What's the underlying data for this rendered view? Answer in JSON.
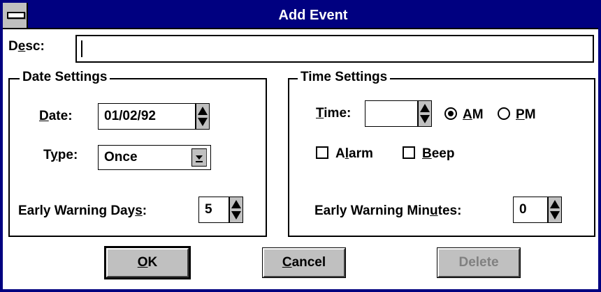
{
  "window": {
    "title": "Add Event"
  },
  "desc": {
    "label_pre": "D",
    "label_acc": "e",
    "label_post": "sc:",
    "value": ""
  },
  "date_settings": {
    "title": "Date Settings",
    "date_label_acc": "D",
    "date_label_post": "ate:",
    "date_value": "01/02/92",
    "type_label_pre": "T",
    "type_label_acc": "y",
    "type_label_post": "pe:",
    "type_value": "Once",
    "warn_label_pre": "Early Warning Day",
    "warn_label_acc": "s",
    "warn_label_post": ":",
    "warn_value": "5"
  },
  "time_settings": {
    "title": "Time Settings",
    "time_label_acc": "T",
    "time_label_post": "ime:",
    "time_value": "",
    "am_acc": "A",
    "am_post": "M",
    "pm_acc": "P",
    "pm_post": "M",
    "selected": "AM",
    "alarm_pre": "A",
    "alarm_acc": "l",
    "alarm_post": "arm",
    "beep_acc": "B",
    "beep_post": "eep",
    "warn_label_pre": "Early Warning Min",
    "warn_label_acc": "u",
    "warn_label_post": "tes:",
    "warn_value": "0"
  },
  "buttons": {
    "ok_acc": "O",
    "ok_post": "K",
    "cancel_acc": "C",
    "cancel_post": "ancel",
    "delete": "Delete"
  }
}
